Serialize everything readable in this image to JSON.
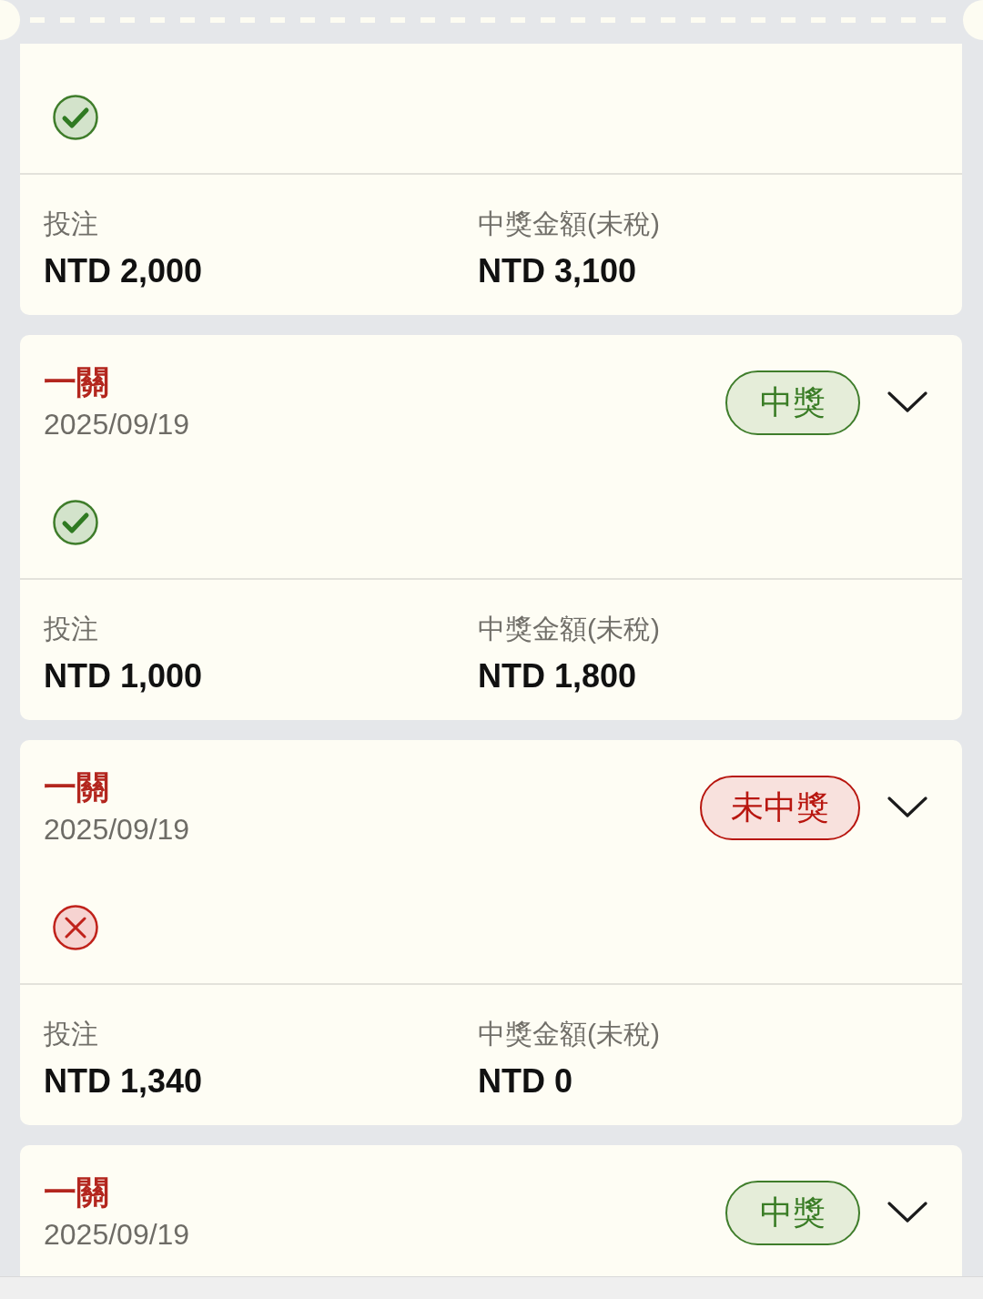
{
  "tickets": [
    {
      "kind": "won",
      "stake": {
        "label": "投注",
        "value": "NTD 2,000"
      },
      "payout": {
        "label": "中獎金額(未稅)",
        "value": "NTD 3,100"
      }
    },
    {
      "title": "一關",
      "date": "2025/09/19",
      "badge": "中獎",
      "kind": "won",
      "stake": {
        "label": "投注",
        "value": "NTD 1,000"
      },
      "payout": {
        "label": "中獎金額(未稅)",
        "value": "NTD 1,800"
      }
    },
    {
      "title": "一關",
      "date": "2025/09/19",
      "badge": "未中獎",
      "kind": "lost",
      "stake": {
        "label": "投注",
        "value": "NTD 1,340"
      },
      "payout": {
        "label": "中獎金額(未稅)",
        "value": "NTD 0"
      }
    },
    {
      "title": "一關",
      "date": "2025/09/19",
      "badge": "中獎",
      "kind": "won"
    }
  ]
}
